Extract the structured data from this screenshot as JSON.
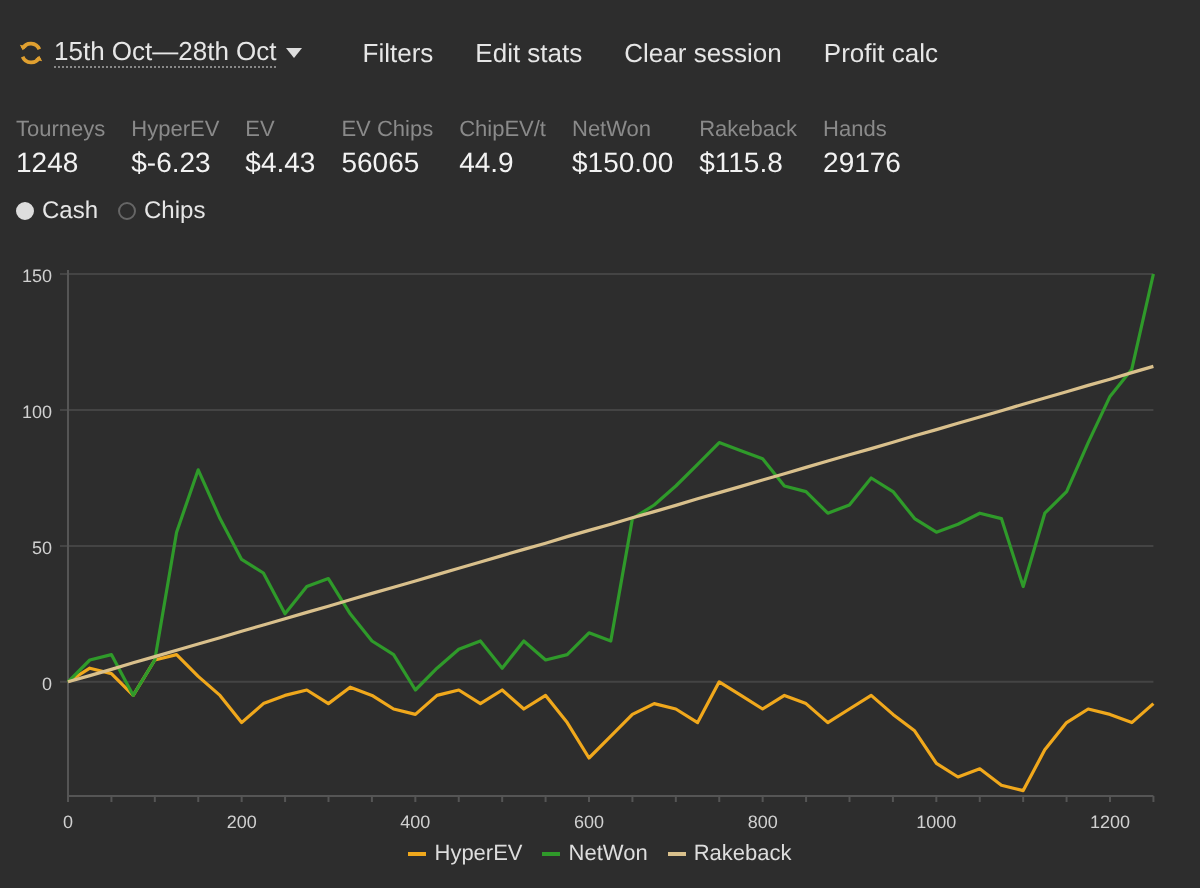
{
  "toolbar": {
    "date_range": "15th Oct—28th Oct",
    "menu": [
      "Filters",
      "Edit stats",
      "Clear session",
      "Profit calc"
    ]
  },
  "stats": [
    {
      "label": "Tourneys",
      "value": "1248"
    },
    {
      "label": "HyperEV",
      "value": "$-6.23"
    },
    {
      "label": "EV",
      "value": "$4.43"
    },
    {
      "label": "EV Chips",
      "value": "56065"
    },
    {
      "label": "ChipEV/t",
      "value": "44.9"
    },
    {
      "label": "NetWon",
      "value": "$150.00"
    },
    {
      "label": "Rakeback",
      "value": "$115.8"
    },
    {
      "label": "Hands",
      "value": "29176"
    }
  ],
  "view_options": [
    {
      "label": "Cash",
      "selected": true
    },
    {
      "label": "Chips",
      "selected": false
    }
  ],
  "chart": {
    "chart_data": {
      "type": "line",
      "x": [
        0,
        25,
        50,
        75,
        100,
        125,
        150,
        175,
        200,
        225,
        250,
        275,
        300,
        325,
        350,
        375,
        400,
        425,
        450,
        475,
        500,
        525,
        550,
        575,
        600,
        625,
        650,
        675,
        700,
        725,
        750,
        775,
        800,
        825,
        850,
        875,
        900,
        925,
        950,
        975,
        1000,
        1025,
        1050,
        1075,
        1100,
        1125,
        1150,
        1175,
        1200,
        1225,
        1250
      ],
      "series": [
        {
          "name": "HyperEV",
          "color": "#f0a81c",
          "values": [
            0,
            5,
            3,
            -5,
            8,
            10,
            2,
            -5,
            -15,
            -8,
            -5,
            -3,
            -8,
            -2,
            -5,
            -10,
            -12,
            -5,
            -3,
            -8,
            -3,
            -10,
            -5,
            -15,
            -28,
            -20,
            -12,
            -8,
            -10,
            -15,
            0,
            -5,
            -10,
            -5,
            -8,
            -15,
            -10,
            -5,
            -12,
            -18,
            -30,
            -35,
            -32,
            -38,
            -40,
            -25,
            -15,
            -10,
            -12,
            -15,
            -8
          ]
        },
        {
          "name": "NetWon",
          "color": "#2f9a2a",
          "values": [
            0,
            8,
            10,
            -5,
            8,
            55,
            78,
            60,
            45,
            40,
            25,
            35,
            38,
            25,
            15,
            10,
            -3,
            5,
            12,
            15,
            5,
            15,
            8,
            10,
            18,
            15,
            60,
            65,
            72,
            80,
            88,
            85,
            82,
            72,
            70,
            62,
            65,
            75,
            70,
            60,
            55,
            58,
            62,
            60,
            35,
            62,
            70,
            88,
            105,
            115,
            150
          ]
        },
        {
          "name": "Rakeback",
          "color": "#d9c08c",
          "values": [
            0,
            2.3,
            4.6,
            7,
            9.3,
            11.6,
            13.9,
            16.2,
            18.6,
            20.9,
            23.2,
            25.5,
            27.8,
            30.2,
            32.5,
            34.8,
            37.1,
            39.4,
            41.8,
            44.1,
            46.4,
            48.7,
            51,
            53.4,
            55.7,
            58,
            60.3,
            62.6,
            64.9,
            67.3,
            69.6,
            71.9,
            74.2,
            76.5,
            78.9,
            81.2,
            83.5,
            85.8,
            88.1,
            90.5,
            92.8,
            95.1,
            97.4,
            99.7,
            102.1,
            104.4,
            106.7,
            109,
            111.3,
            113.7,
            116
          ]
        }
      ],
      "xlim": [
        0,
        1250
      ],
      "ylim": [
        -42,
        150
      ],
      "grid": true,
      "legend": "bottom",
      "xticks": [
        0,
        200,
        400,
        600,
        800,
        1000,
        1200
      ],
      "yticks": [
        0,
        50,
        100,
        150
      ]
    }
  }
}
